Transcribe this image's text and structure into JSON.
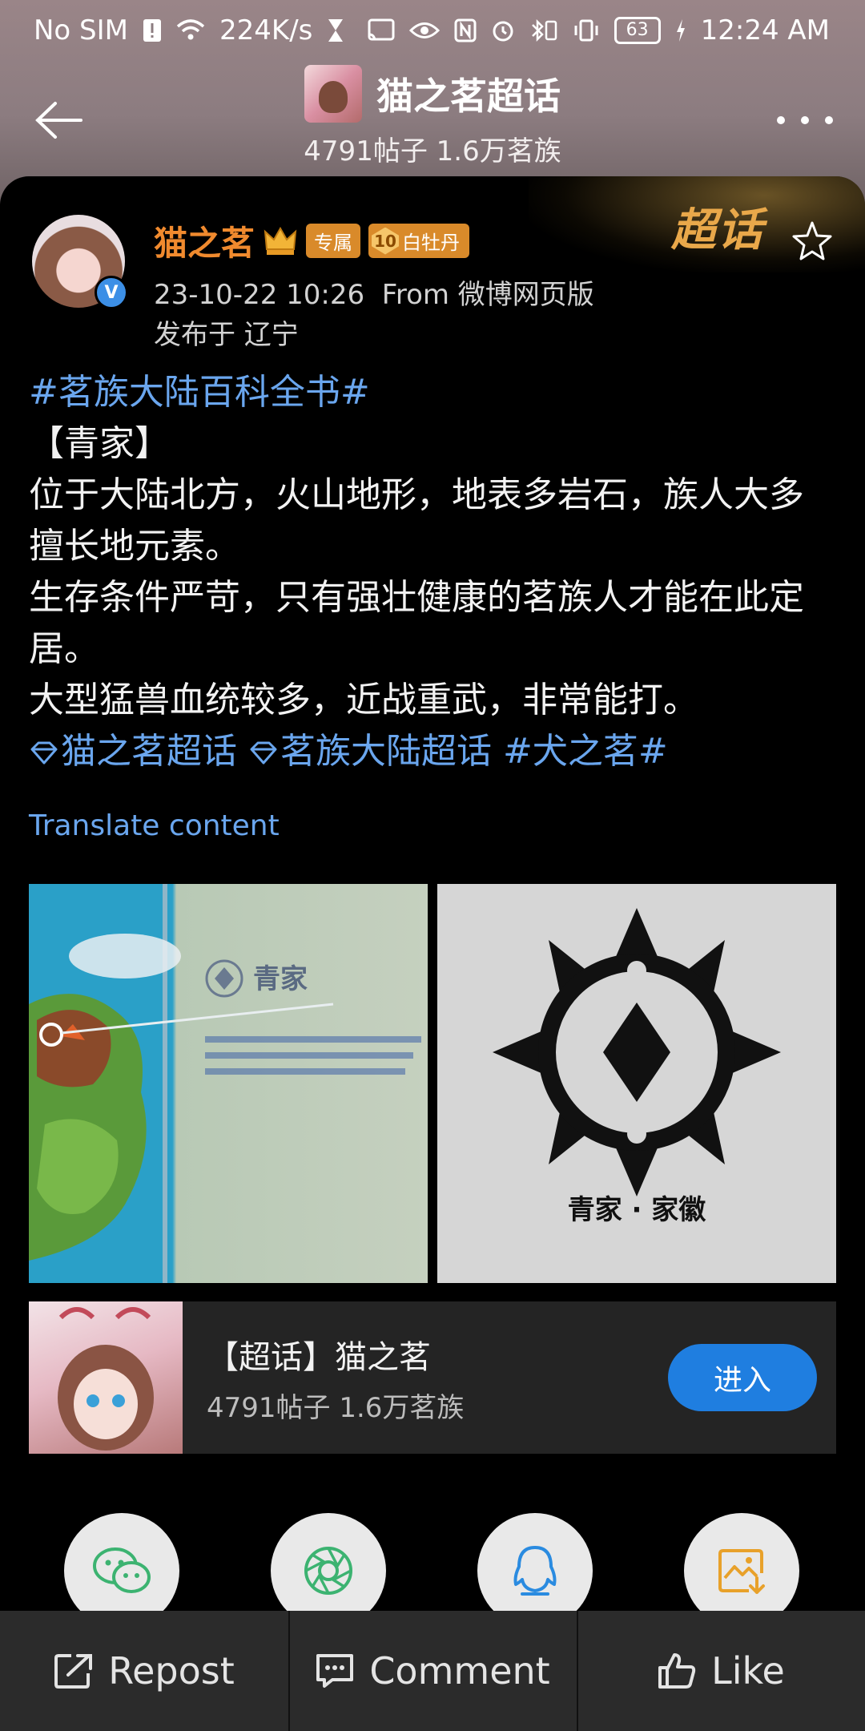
{
  "status_bar": {
    "carrier": "No SIM",
    "speed": "224K/s",
    "battery": "63",
    "time": "12:24 AM"
  },
  "header": {
    "title": "猫之茗超话",
    "subtitle": "4791帖子 1.6万茗族"
  },
  "card_badge": {
    "label": "超话"
  },
  "post": {
    "username": "猫之茗",
    "tag_exclusive": "专属",
    "level": "10",
    "level_name": "白牡丹",
    "timestamp": "23-10-22 10:26",
    "source": "From 微博网页版",
    "location": "发布于 辽宁",
    "hashtag": "#茗族大陆百科全书#",
    "lines": [
      "【青家】",
      "位于大陆北方，火山地形，地表多岩石，族人大多擅长地元素。",
      "生存条件严苛，只有强壮健康的茗族人才能在此定居。",
      "大型猛兽血统较多，近战重武，非常能打。"
    ],
    "topic_1": "猫之茗超话",
    "topic_2": "茗族大陆超话",
    "topic_3": "#犬之茗#",
    "translate": "Translate content"
  },
  "images": {
    "map_label": "青家",
    "emblem_label": "青家 · 家徽"
  },
  "super_topic": {
    "title": "【超话】猫之茗",
    "subtitle": "4791帖子 1.6万茗族",
    "enter_label": "进入"
  },
  "share": {
    "icons": [
      "wechat-icon",
      "moments-icon",
      "qq-icon",
      "save-image-icon"
    ]
  },
  "bottom_bar": {
    "repost": "Repost",
    "comment": "Comment",
    "like": "Like"
  },
  "colors": {
    "accent_blue": "#6aa6ee",
    "username_orange": "#f08a2e",
    "enter_button": "#1f7ee0",
    "wechat_green": "#3cb371",
    "qq_blue": "#2a8be0",
    "save_orange": "#e8a12a"
  }
}
